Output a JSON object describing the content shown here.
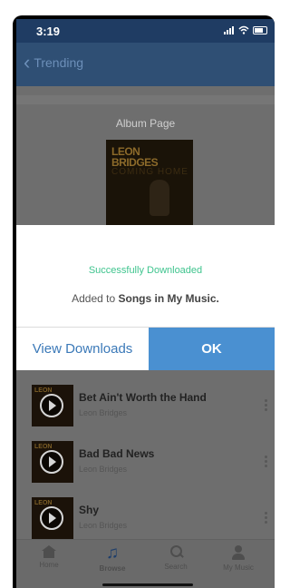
{
  "status_bar": {
    "time": "3:19"
  },
  "nav": {
    "back_label": "Trending"
  },
  "album": {
    "page_title": "Album Page",
    "cover_text_line1": "LEON",
    "cover_text_line2": "BRIDGES",
    "cover_text_line3": "COMING HOME"
  },
  "songs": [
    {
      "title": "Bet Ain't Worth the Hand",
      "artist": "Leon Bridges"
    },
    {
      "title": "Bad Bad News",
      "artist": "Leon Bridges"
    },
    {
      "title": "Shy",
      "artist": "Leon Bridges"
    }
  ],
  "dialog": {
    "title": "Successfully Downloaded",
    "message_prefix": "Added to ",
    "message_bold": "Songs in My Music.",
    "view_downloads_label": "View Downloads",
    "ok_label": "OK"
  },
  "tabs": [
    {
      "label": "Home",
      "icon": "home-icon"
    },
    {
      "label": "Browse",
      "icon": "music-note-icon"
    },
    {
      "label": "Search",
      "icon": "search-icon"
    },
    {
      "label": "My Music",
      "icon": "user-icon"
    }
  ],
  "colors": {
    "nav_bar": "#2f4f74",
    "success_text": "#3fc48e",
    "ok_button": "#4a90d1",
    "link_text": "#3b79b8"
  }
}
